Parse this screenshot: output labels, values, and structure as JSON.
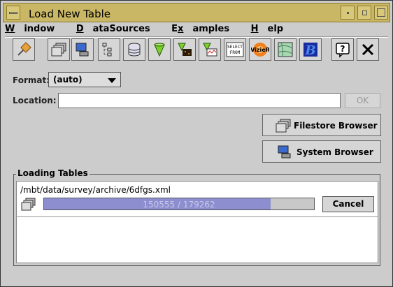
{
  "window": {
    "title": "Load New Table"
  },
  "menubar": [
    {
      "label": "Window",
      "mnemonic": "W"
    },
    {
      "label": "DataSources",
      "mnemonic": "D"
    },
    {
      "label": "Examples",
      "mnemonic": "x"
    },
    {
      "label": "Help",
      "mnemonic": "H"
    }
  ],
  "toolbar": {
    "icons": [
      "pin-icon",
      "folder-browser-icon",
      "system-browser-icon",
      "tree-icon",
      "database-icon",
      "cone-icon",
      "cone-image-icon",
      "cone-plot-icon",
      "sql-query-icon",
      "vizier-icon",
      "sky-map-icon",
      "b-icon",
      "help-icon",
      "close-icon"
    ],
    "sql_text": "SELECT\nFROM",
    "vizier_text": "VizieR",
    "b_text": "B",
    "help_text": "?",
    "close_text": "✕"
  },
  "form": {
    "format_label": "Format:",
    "format_value": "(auto)",
    "location_label": "Location:",
    "location_value": "",
    "ok_label": "OK"
  },
  "buttons": {
    "filestore": "Filestore Browser",
    "system": "System Browser"
  },
  "loading": {
    "title": "Loading Tables",
    "path": "/mbt/data/survey/archive/6dfgs.xml",
    "progress_text": "150555 / 179262",
    "current": 150555,
    "total": 179262,
    "cancel_label": "Cancel"
  }
}
